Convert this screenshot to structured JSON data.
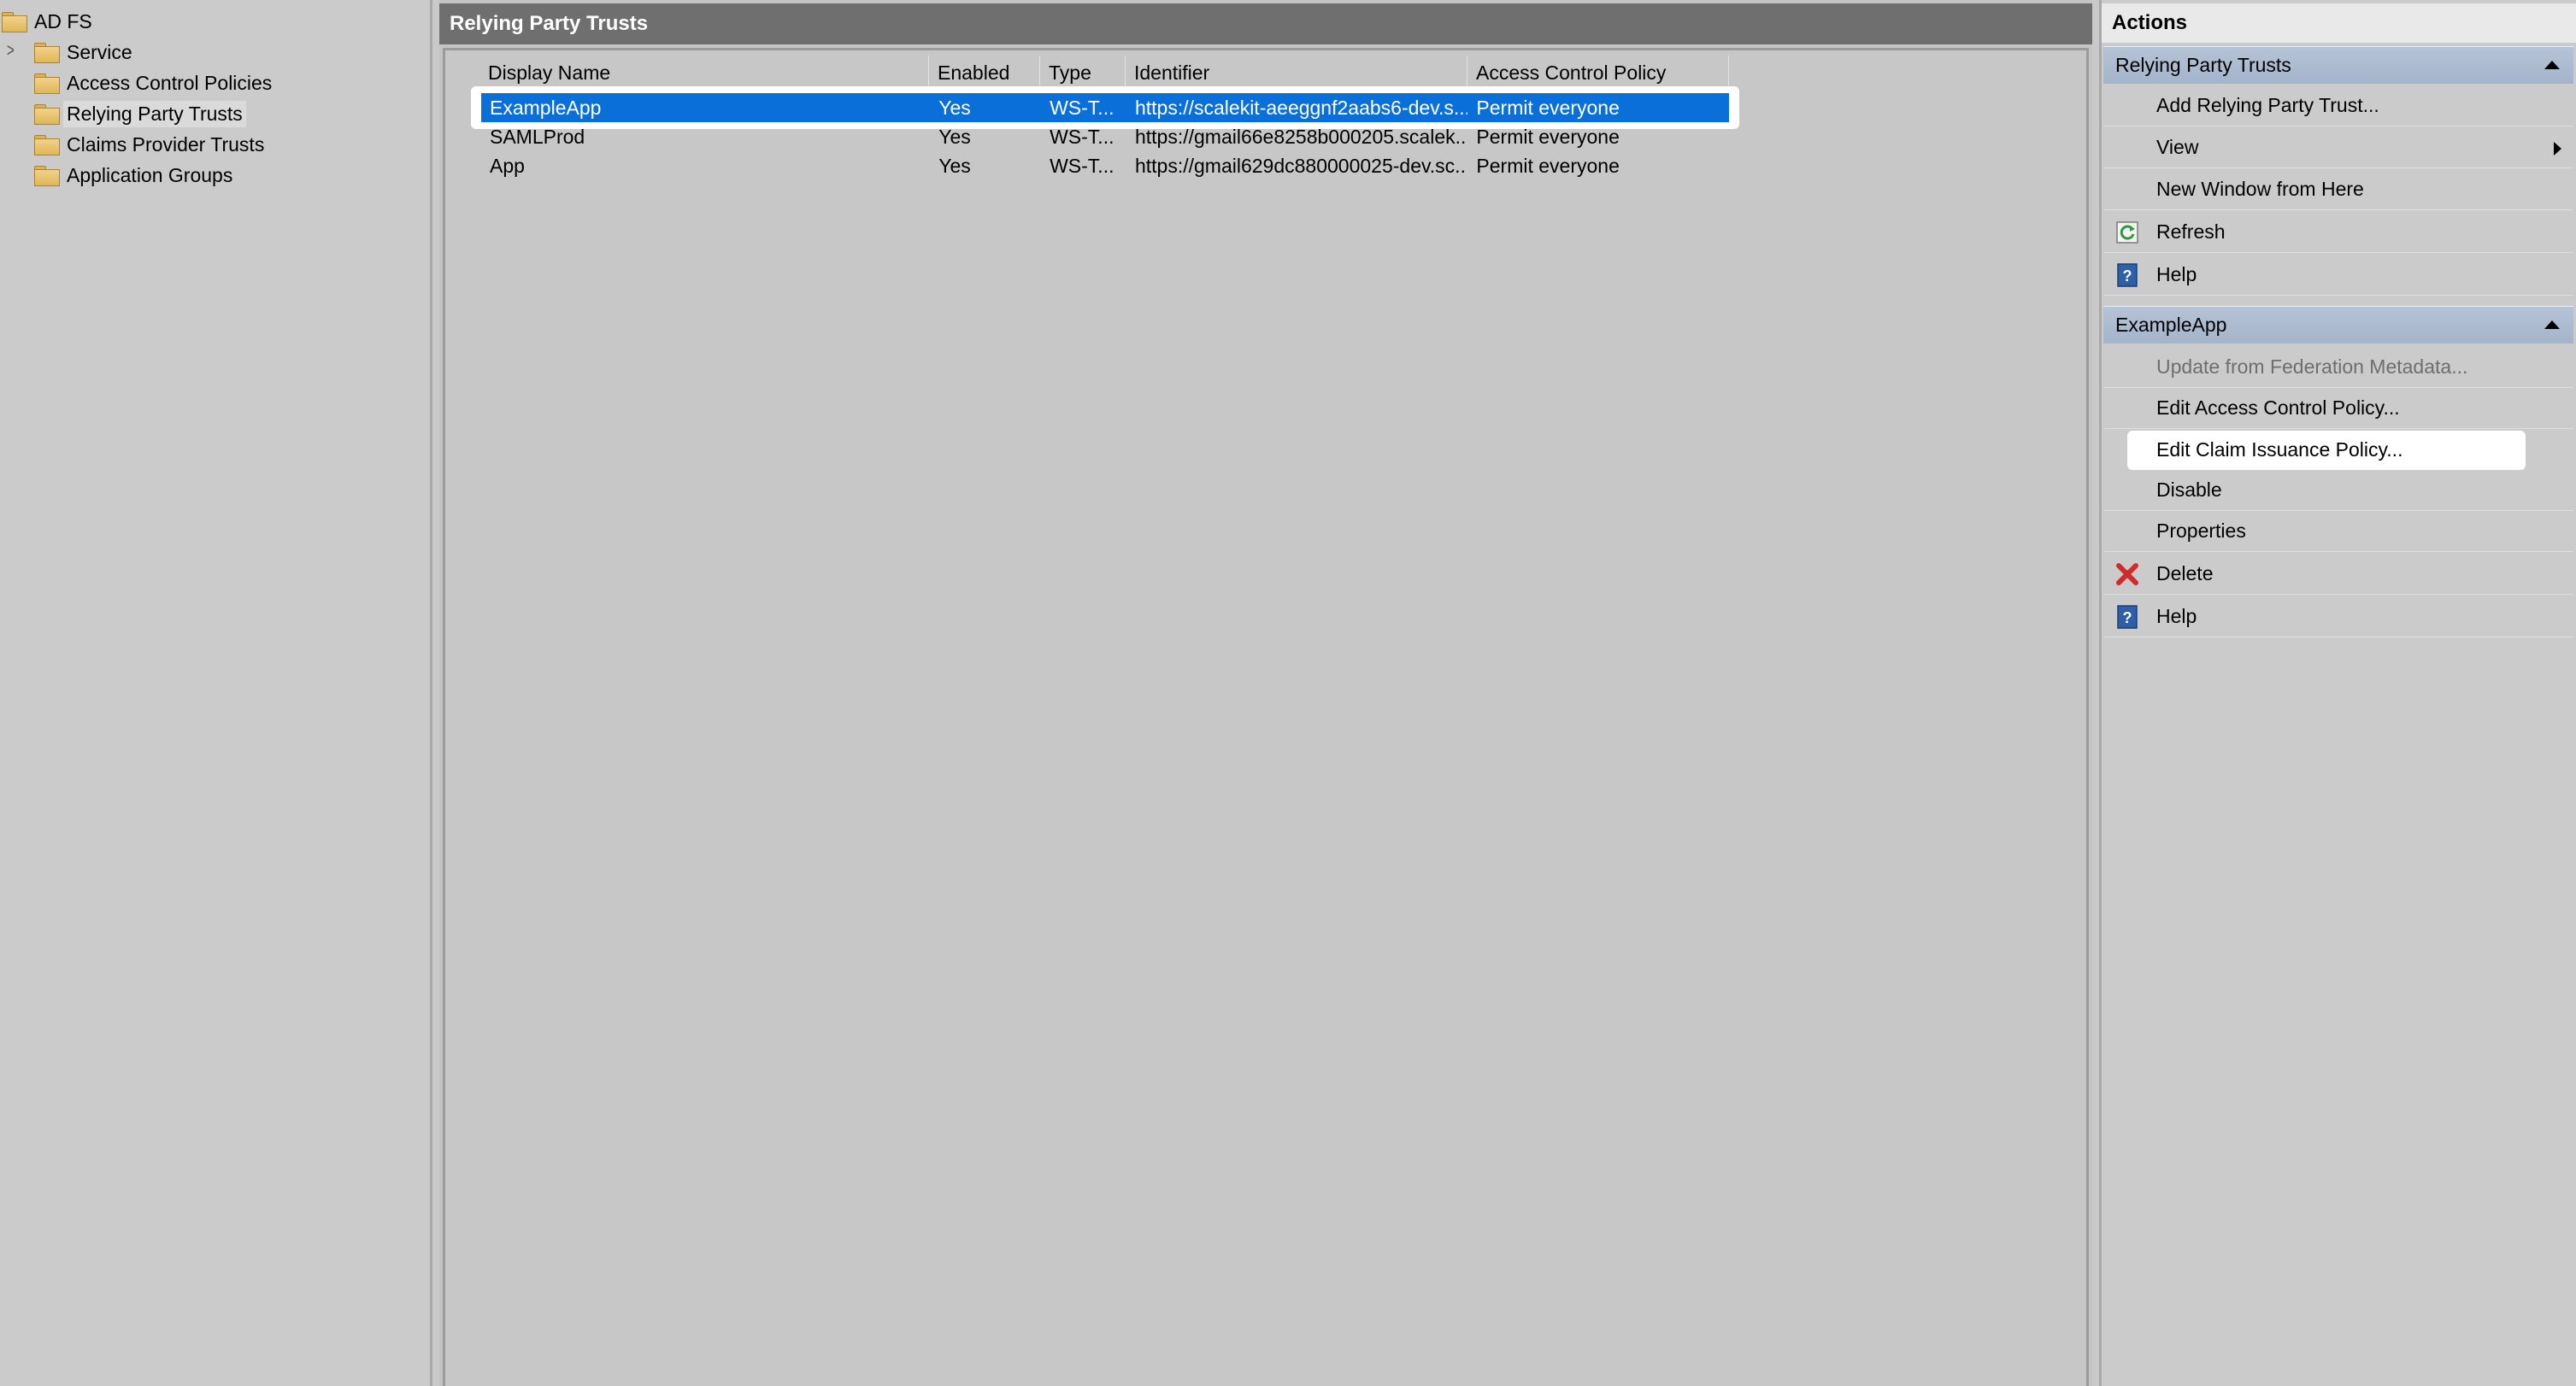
{
  "tree": {
    "root_label": "AD FS",
    "items": [
      {
        "label": "Service",
        "expandable": true
      },
      {
        "label": "Access Control Policies"
      },
      {
        "label": "Relying Party Trusts",
        "selected": true
      },
      {
        "label": "Claims Provider Trusts"
      },
      {
        "label": "Application Groups"
      }
    ]
  },
  "center": {
    "title": "Relying Party Trusts",
    "columns": [
      "Display Name",
      "Enabled",
      "Type",
      "Identifier",
      "Access Control Policy"
    ],
    "rows": [
      {
        "display_name": "ExampleApp",
        "enabled": "Yes",
        "type": "WS-T...",
        "identifier": "https://scalekit-aeeggnf2aabs6-dev.s...",
        "policy": "Permit everyone",
        "selected": true
      },
      {
        "display_name": "SAMLProd",
        "enabled": "Yes",
        "type": "WS-T...",
        "identifier": "https://gmail66e8258b000205.scalek...",
        "policy": "Permit everyone"
      },
      {
        "display_name": "App",
        "enabled": "Yes",
        "type": "WS-T...",
        "identifier": "https://gmail629dc880000025-dev.sc...",
        "policy": "Permit everyone"
      }
    ]
  },
  "actions": {
    "title": "Actions",
    "sections": [
      {
        "header": "Relying Party Trusts",
        "items": [
          {
            "label": "Add Relying Party Trust..."
          },
          {
            "label": "View",
            "submenu": true
          },
          {
            "label": "New Window from Here"
          },
          {
            "label": "Refresh",
            "icon": "refresh-icon"
          },
          {
            "label": "Help",
            "icon": "help-icon"
          }
        ]
      },
      {
        "header": "ExampleApp",
        "items": [
          {
            "label": "Update from Federation Metadata...",
            "disabled": true
          },
          {
            "label": "Edit Access Control Policy..."
          },
          {
            "label": "Edit Claim Issuance Policy...",
            "highlighted": true
          },
          {
            "label": "Disable"
          },
          {
            "label": "Properties"
          },
          {
            "label": "Delete",
            "icon": "delete-icon"
          },
          {
            "label": "Help",
            "icon": "help-icon"
          }
        ]
      }
    ]
  },
  "colors": {
    "selection_blue": "#0a6fd8",
    "section_header": "#a9b8cc",
    "center_header": "#6f6f6f"
  }
}
